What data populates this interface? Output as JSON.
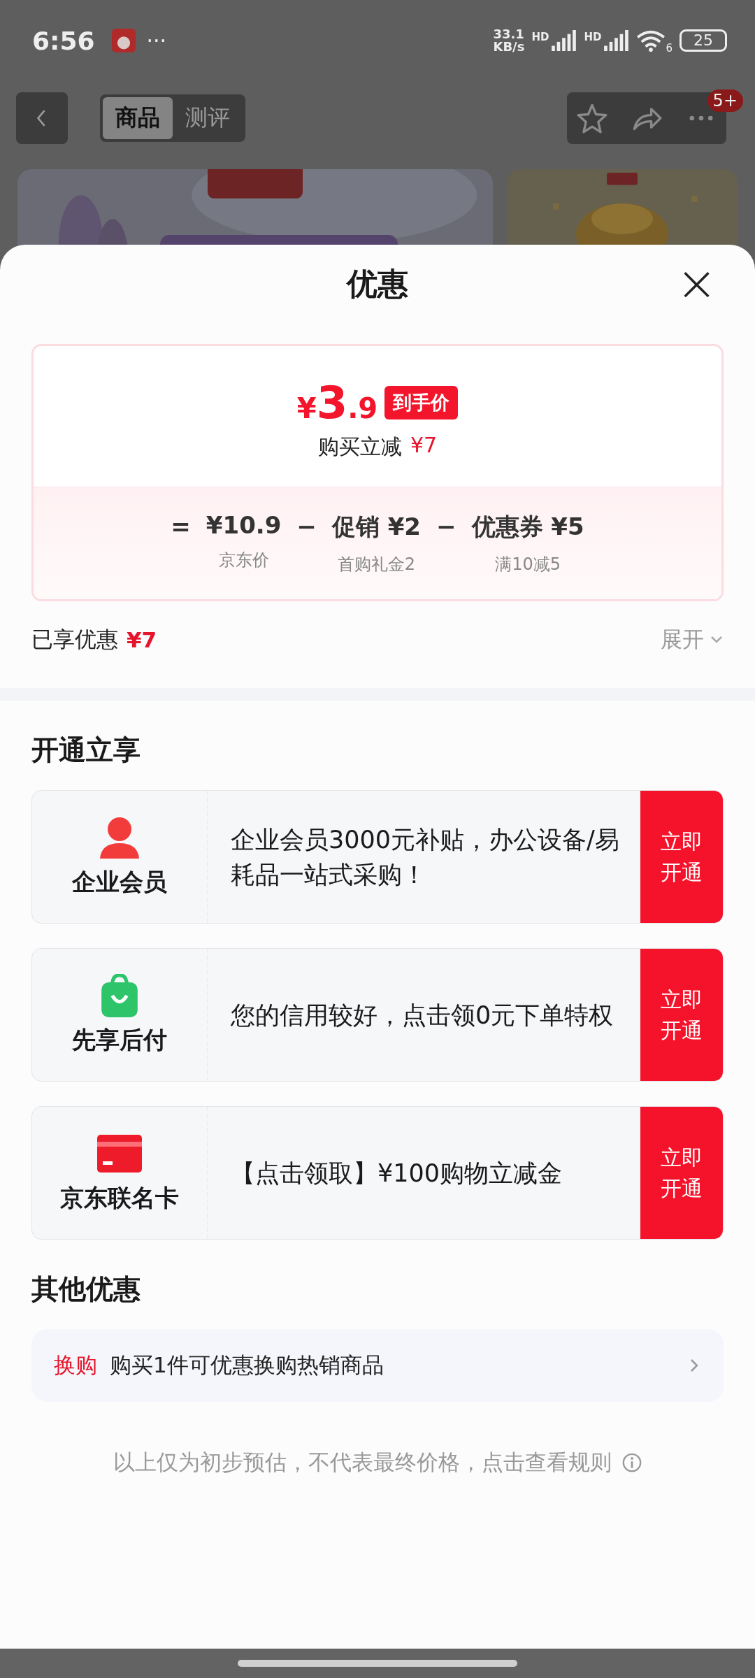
{
  "status_bar": {
    "time": "6:56",
    "more": "···",
    "speed_value": "33.1",
    "speed_unit": "KB/s",
    "sim1": "HD",
    "sim2": "HD",
    "wifi_gen": "6",
    "battery": "25"
  },
  "nav": {
    "tabs": [
      {
        "label": "商品",
        "selected": true
      },
      {
        "label": "测评",
        "selected": false
      }
    ],
    "badge": "5+"
  },
  "sheet": {
    "title": "优惠",
    "close": "×",
    "price": {
      "currency": "¥",
      "integer": "3",
      "decimal": ".9",
      "tag": "到手价",
      "saving_label": "购买立减",
      "saving_value": "¥7"
    },
    "breakdown": [
      {
        "op": "=",
        "value": "¥10.9",
        "note": "京东价"
      },
      {
        "op": "−",
        "value": "促销 ¥2",
        "note": "首购礼金2"
      },
      {
        "op": "−",
        "value": "优惠券 ¥5",
        "note": "满10减5"
      }
    ],
    "enjoyed_label": "已享优惠",
    "enjoyed_value": "¥7",
    "expand": "展开",
    "open_section": {
      "title": "开通立享",
      "offers": [
        {
          "kind": "member",
          "name": "企业会员",
          "text": "企业会员3000元补贴，办公设备/易耗品一站式采购！",
          "button": "立即开通"
        },
        {
          "kind": "bag",
          "name": "先享后付",
          "text": "您的信用较好，点击领0元下单特权",
          "button": "立即开通"
        },
        {
          "kind": "card",
          "name": "京东联名卡",
          "text": "【点击领取】¥100购物立减金",
          "button": "立即开通"
        }
      ]
    },
    "other_section": {
      "title": "其他优惠",
      "rows": [
        {
          "tag": "换购",
          "text": "购买1件可优惠换购热销商品"
        }
      ]
    },
    "footnote": "以上仅为初步预估，不代表最终价格，点击查看规则"
  }
}
